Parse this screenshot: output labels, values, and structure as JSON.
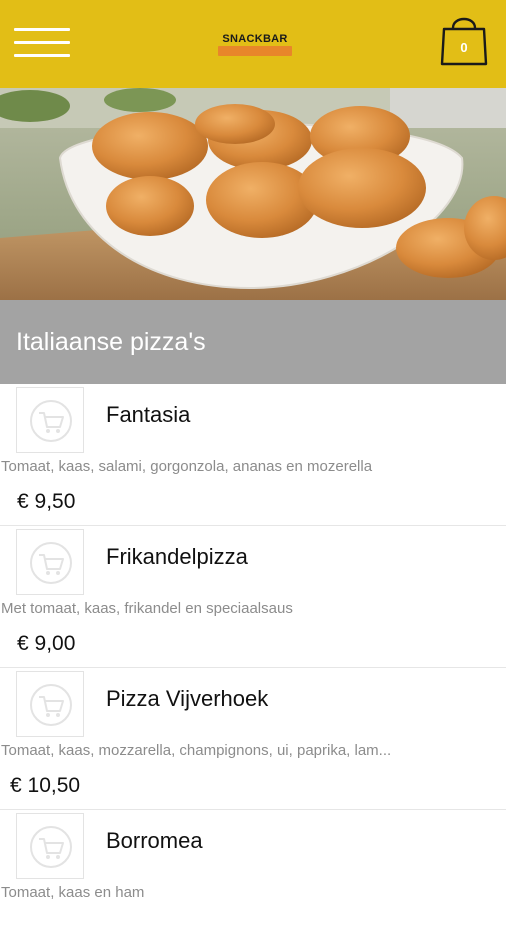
{
  "header": {
    "logo_text": "SNACKBAR",
    "cart_count": "0",
    "colors": {
      "bar": "#e2be16",
      "logo_accent": "#e8862a"
    }
  },
  "hero": {
    "image": "chicken-nuggets-photo"
  },
  "category": {
    "title": "Italiaanse pizza's",
    "bar_color": "#a3a3a3"
  },
  "products": [
    {
      "name": "Fantasia",
      "description": "Tomaat, kaas, salami, gorgonzola, ananas en mozerella",
      "price": "€ 9,50"
    },
    {
      "name": "Frikandelpizza",
      "description": "Met tomaat, kaas, frikandel en speciaalsaus",
      "price": "€ 9,00"
    },
    {
      "name": "Pizza Vijverhoek",
      "description": "Tomaat, kaas, mozzarella, champignons, ui, paprika, lam...",
      "price": "€ 10,50"
    },
    {
      "name": "Borromea",
      "description": "Tomaat, kaas en ham",
      "price": ""
    }
  ]
}
